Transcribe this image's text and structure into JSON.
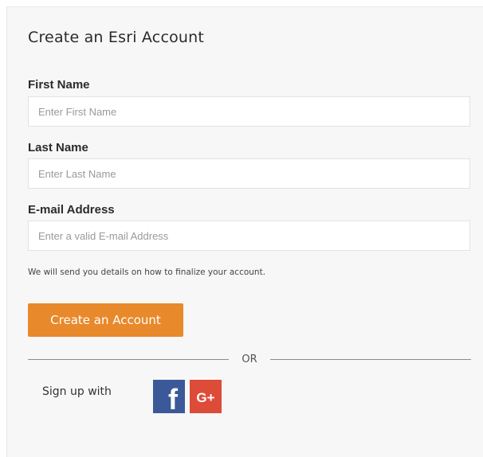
{
  "form": {
    "title": "Create an Esri Account",
    "first_name": {
      "label": "First Name",
      "placeholder": "Enter First Name",
      "value": ""
    },
    "last_name": {
      "label": "Last Name",
      "placeholder": "Enter Last Name",
      "value": ""
    },
    "email": {
      "label": "E-mail Address",
      "placeholder": "Enter a valid E-mail Address",
      "value": ""
    },
    "helper_text": "We will send you details on how to finalize your account.",
    "submit_label": "Create an Account"
  },
  "divider": {
    "label": "OR"
  },
  "social": {
    "prompt": "Sign up with",
    "providers": [
      {
        "name": "facebook-icon",
        "glyph": "f",
        "color": "#3b5998"
      },
      {
        "name": "google-plus-icon",
        "glyph": "G+",
        "color": "#dd4b39"
      }
    ]
  },
  "colors": {
    "accent": "#e8892b",
    "panel_bg": "#f7f7f7",
    "input_border": "#e3e3e3"
  }
}
